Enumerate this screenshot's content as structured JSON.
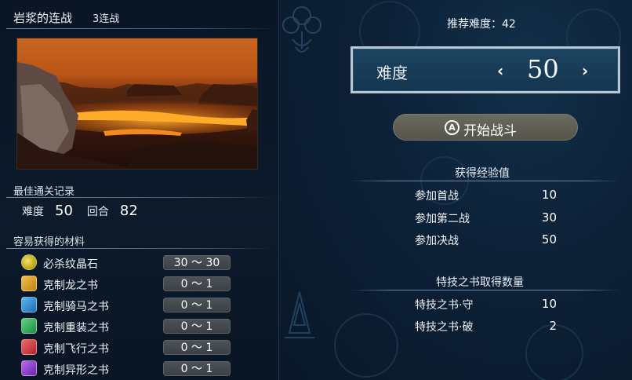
{
  "header": {
    "title": "岩浆的连战",
    "subtitle": "3连战"
  },
  "best_record": {
    "label": "最佳通关记录",
    "difficulty_label": "难度",
    "difficulty_value": "50",
    "turns_label": "回合",
    "turns_value": "82"
  },
  "materials": {
    "label": "容易获得的材料",
    "items": [
      {
        "name": "必杀纹晶石",
        "range": "30 ～ 30",
        "icon": "crystal-orb-icon",
        "color": "#c9b21a"
      },
      {
        "name": "克制龙之书",
        "range": "0 ～  1",
        "icon": "dragon-book-icon",
        "color": "#d39a1e"
      },
      {
        "name": "克制骑马之书",
        "range": "0 ～  1",
        "icon": "cavalry-book-icon",
        "color": "#2f8fd6"
      },
      {
        "name": "克制重装之书",
        "range": "0 ～  1",
        "icon": "armor-book-icon",
        "color": "#2eae56"
      },
      {
        "name": "克制飞行之书",
        "range": "0 ～  1",
        "icon": "flying-book-icon",
        "color": "#d23d3d"
      },
      {
        "name": "克制异形之书",
        "range": "0 ～  1",
        "icon": "monster-book-icon",
        "color": "#8a3fc8"
      }
    ]
  },
  "recommended": "推荐难度：42",
  "difficulty": {
    "label": "难度",
    "value": "50",
    "prev": "‹",
    "next": "›"
  },
  "start_button": {
    "badge": "A",
    "label": "开始战斗"
  },
  "exp": {
    "label": "获得经验值",
    "rows": [
      {
        "name": "参加首战",
        "value": "10"
      },
      {
        "name": "参加第二战",
        "value": "30"
      },
      {
        "name": "参加决战",
        "value": "50"
      }
    ]
  },
  "skill_books": {
    "label": "特技之书取得数量",
    "rows": [
      {
        "name": "特技之书·守",
        "value": "10"
      },
      {
        "name": "特技之书·破",
        "value": "2"
      }
    ]
  }
}
